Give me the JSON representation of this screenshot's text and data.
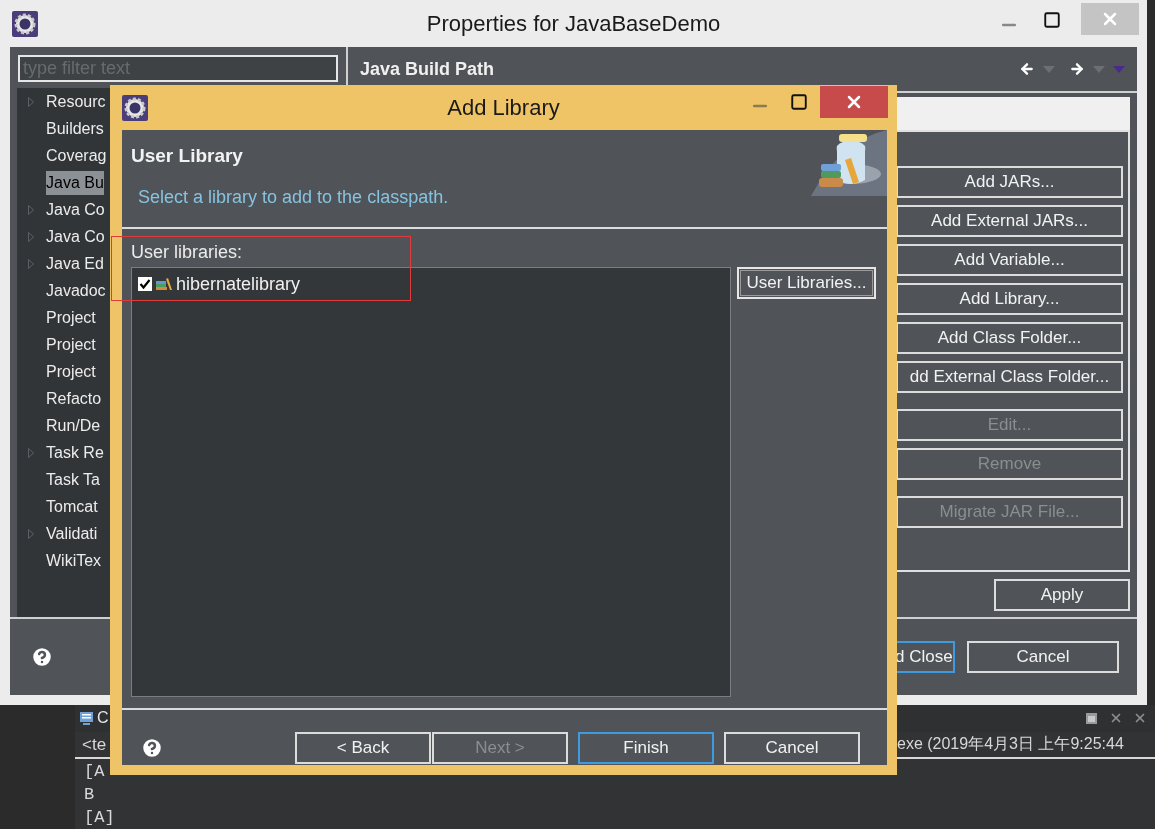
{
  "properties_window": {
    "title": "Properties for JavaBaseDemo",
    "filter_placeholder": "type filter text",
    "tree": [
      {
        "label": "Resourc",
        "expandable": true,
        "selected": false
      },
      {
        "label": "Builders",
        "expandable": false,
        "selected": false
      },
      {
        "label": "Coverag",
        "expandable": false,
        "selected": false
      },
      {
        "label": "Java Bu",
        "expandable": false,
        "selected": true
      },
      {
        "label": "Java Co",
        "expandable": true,
        "selected": false
      },
      {
        "label": "Java Co",
        "expandable": true,
        "selected": false
      },
      {
        "label": "Java Ed",
        "expandable": true,
        "selected": false
      },
      {
        "label": "Javadoc",
        "expandable": false,
        "selected": false
      },
      {
        "label": "Project",
        "expandable": false,
        "selected": false
      },
      {
        "label": "Project",
        "expandable": false,
        "selected": false
      },
      {
        "label": "Project",
        "expandable": false,
        "selected": false
      },
      {
        "label": "Refacto",
        "expandable": false,
        "selected": false
      },
      {
        "label": "Run/De",
        "expandable": false,
        "selected": false
      },
      {
        "label": "Task Re",
        "expandable": true,
        "selected": false
      },
      {
        "label": "Task Ta",
        "expandable": false,
        "selected": false
      },
      {
        "label": "Tomcat",
        "expandable": false,
        "selected": false
      },
      {
        "label": "Validati",
        "expandable": true,
        "selected": false
      },
      {
        "label": "WikiTex",
        "expandable": false,
        "selected": false
      }
    ],
    "page_title": "Java Build Path",
    "button_groups": [
      [
        {
          "label": "Add JARs...",
          "disabled": false
        },
        {
          "label": "Add External JARs...",
          "disabled": false
        },
        {
          "label": "Add Variable...",
          "disabled": false
        },
        {
          "label": "Add Library...",
          "disabled": false
        },
        {
          "label": "Add Class Folder...",
          "disabled": false
        },
        {
          "label": "dd External Class Folder...",
          "disabled": false
        }
      ],
      [
        {
          "label": "Edit...",
          "disabled": true
        },
        {
          "label": "Remove",
          "disabled": true
        }
      ],
      [
        {
          "label": "Migrate JAR File...",
          "disabled": true
        }
      ]
    ],
    "apply": "Apply",
    "footer_buttons": [
      {
        "label": "d Close",
        "default": true
      },
      {
        "label": "Cancel",
        "default": false
      }
    ]
  },
  "dialog": {
    "title": "Add Library",
    "heading": "User Library",
    "description": "Select a library to add to the classpath.",
    "list_label": "User libraries:",
    "libraries": [
      {
        "name": "hibernatelibrary",
        "checked": true
      }
    ],
    "side_button": "User Libraries...",
    "buttons": [
      {
        "label": "< Back",
        "disabled": false,
        "default": false
      },
      {
        "label": "Next >",
        "disabled": true,
        "default": false
      },
      {
        "label": "Finish",
        "disabled": false,
        "default": true
      },
      {
        "label": "Cancel",
        "disabled": false,
        "default": false
      }
    ]
  },
  "console": {
    "tab_title": "C",
    "header_left": "<te",
    "launch_info": "exe (2019年4月3日 上午9:25:44",
    "lines": [
      "[A",
      "B",
      "[A]"
    ]
  }
}
